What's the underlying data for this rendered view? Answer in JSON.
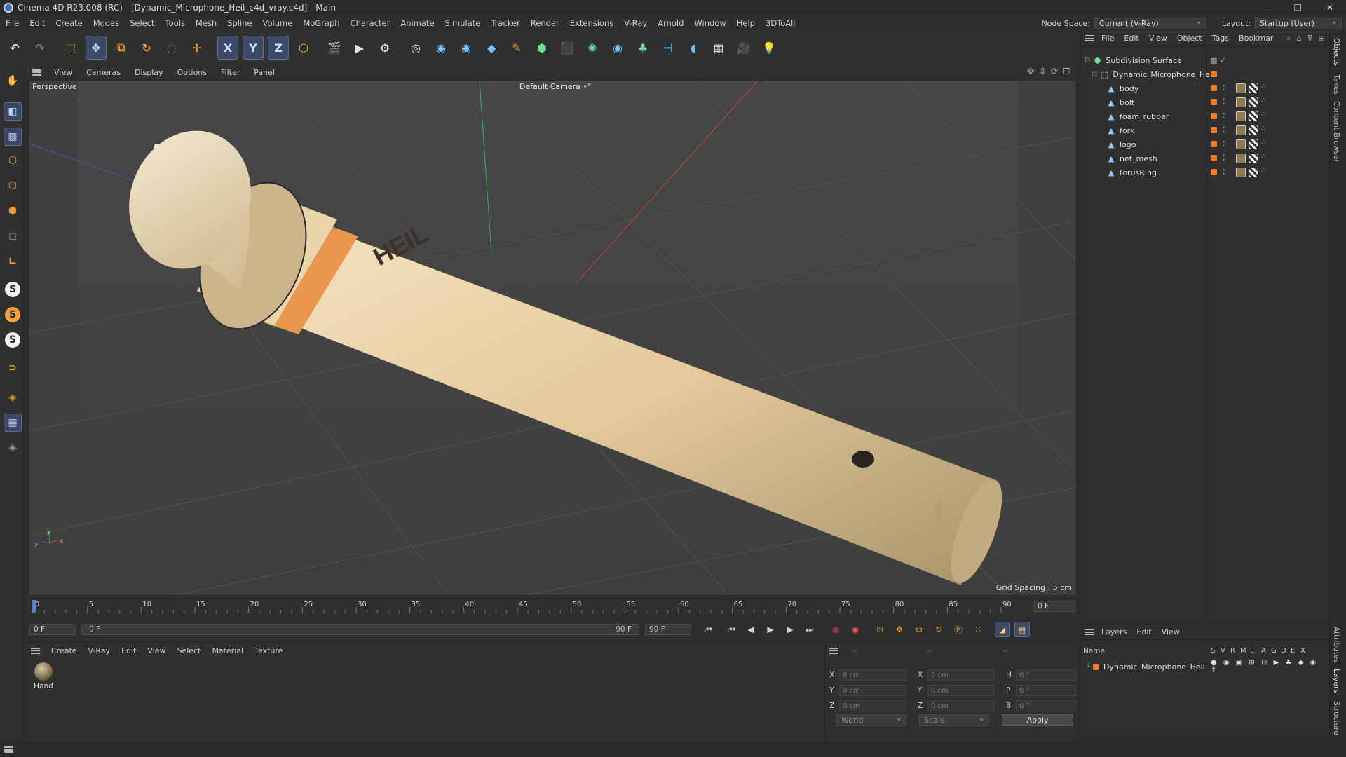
{
  "window": {
    "title": "Cinema 4D R23.008 (RC) - [Dynamic_Microphone_Heil_c4d_vray.c4d] - Main",
    "controls": [
      "—",
      "❐",
      "✕"
    ]
  },
  "menubar": {
    "items": [
      "File",
      "Edit",
      "Create",
      "Modes",
      "Select",
      "Tools",
      "Mesh",
      "Spline",
      "Volume",
      "MoGraph",
      "Character",
      "Animate",
      "Simulate",
      "Tracker",
      "Render",
      "Extensions",
      "V-Ray",
      "Arnold",
      "Window",
      "Help",
      "3DToAll"
    ],
    "node_space_label": "Node Space:",
    "node_space_value": "Current (V-Ray)",
    "layout_label": "Layout:",
    "layout_value": "Startup (User)"
  },
  "toolbar": {
    "x_label": "X",
    "y_label": "Y",
    "z_label": "Z"
  },
  "viewport": {
    "menu": [
      "View",
      "Cameras",
      "Display",
      "Options",
      "Filter",
      "Panel"
    ],
    "label": "Perspective",
    "camera": "Default Camera",
    "camera_icon": "•°",
    "grid_spacing": "Grid Spacing : 5 cm",
    "axis_labels": {
      "z": "z",
      "y": "y",
      "x": "x"
    },
    "logo_text": "HEIL"
  },
  "timeline": {
    "ticks": [
      "0",
      "5",
      "10",
      "15",
      "20",
      "25",
      "30",
      "35",
      "40",
      "45",
      "50",
      "55",
      "60",
      "65",
      "70",
      "75",
      "80",
      "85",
      "90"
    ],
    "current_frame": "0 F",
    "start_frame": "0 F",
    "range_start": "0 F",
    "range_end": "90 F",
    "end_frame": "90 F"
  },
  "materials": {
    "menu": [
      "Create",
      "V-Ray",
      "Edit",
      "View",
      "Select",
      "Material",
      "Texture"
    ],
    "items": [
      {
        "label": "Hand"
      }
    ]
  },
  "coordinates": {
    "header": [
      "--",
      "--",
      "--"
    ],
    "rows": [
      {
        "a": "X",
        "av": "0 cm",
        "b": "X",
        "bv": "0 cm",
        "c": "H",
        "cv": "0 °"
      },
      {
        "a": "Y",
        "av": "0 cm",
        "b": "Y",
        "bv": "0 cm",
        "c": "P",
        "cv": "0 °"
      },
      {
        "a": "Z",
        "av": "0 cm",
        "b": "Z",
        "bv": "0 cm",
        "c": "B",
        "cv": "0 °"
      }
    ],
    "space": "World",
    "mode": "Scale",
    "apply": "Apply"
  },
  "objects": {
    "menu": [
      "File",
      "Edit",
      "View",
      "Object",
      "Tags",
      "Bookmar"
    ],
    "tree": [
      {
        "name": "Subdivision Surface",
        "level": 0
      },
      {
        "name": "Dynamic_Microphone_Heil",
        "level": 1
      },
      {
        "name": "body",
        "level": 2
      },
      {
        "name": "bolt",
        "level": 2
      },
      {
        "name": "foam_rubber",
        "level": 2
      },
      {
        "name": "fork",
        "level": 2
      },
      {
        "name": "logo",
        "level": 2
      },
      {
        "name": "net_mesh",
        "level": 2
      },
      {
        "name": "torusRing",
        "level": 2
      }
    ]
  },
  "layers": {
    "menu": [
      "Layers",
      "Edit",
      "View"
    ],
    "columns": [
      "Name",
      "S",
      "V",
      "R",
      "M",
      "L",
      "A",
      "G",
      "D",
      "E",
      "X"
    ],
    "rows": [
      {
        "name": "Dynamic_Microphone_Heil"
      }
    ]
  },
  "side_tabs": [
    "Objects",
    "Takes",
    "Content Browser",
    "Attributes",
    "Layers",
    "Structure"
  ],
  "colors": {
    "accent_blue": "#3d4a66",
    "layer_orange": "#f07a2a",
    "mic_body": "#e6cfa4",
    "mic_ring": "#e8974d"
  }
}
